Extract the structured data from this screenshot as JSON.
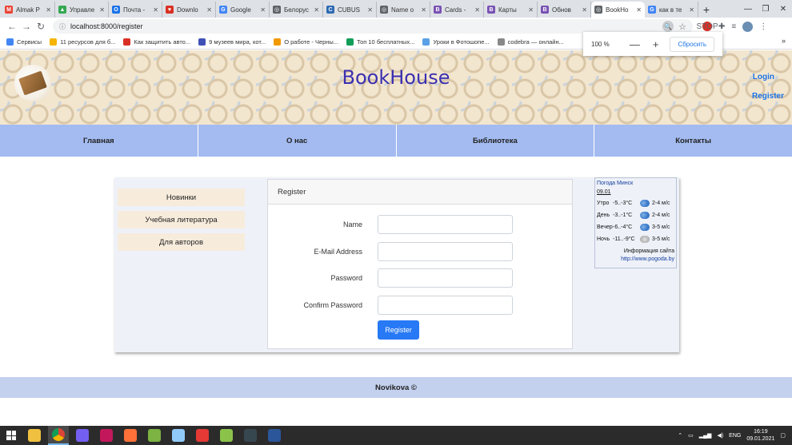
{
  "browser": {
    "tabs": [
      {
        "label": "Almak P",
        "color": "#ea4335",
        "glyph": "M",
        "active": false
      },
      {
        "label": "Управле",
        "color": "#34a853",
        "glyph": "▲",
        "active": false
      },
      {
        "label": "Почта -",
        "color": "#1a73e8",
        "glyph": "O",
        "active": false
      },
      {
        "label": "Downlo",
        "color": "#d93025",
        "glyph": "♥",
        "active": false
      },
      {
        "label": "Google",
        "color": "#4285f4",
        "glyph": "G",
        "active": false
      },
      {
        "label": "Белорус",
        "color": "#5f6368",
        "glyph": "◎",
        "active": false
      },
      {
        "label": "CUBUS",
        "color": "#2d6ab2",
        "glyph": "C",
        "active": false
      },
      {
        "label": "Name o",
        "color": "#5f6368",
        "glyph": "◎",
        "active": false
      },
      {
        "label": "Cards -",
        "color": "#7952b3",
        "glyph": "B",
        "active": false
      },
      {
        "label": "Карты",
        "color": "#7952b3",
        "glyph": "B",
        "active": false
      },
      {
        "label": "Обнов",
        "color": "#7952b3",
        "glyph": "B",
        "active": false
      },
      {
        "label": "BookHo",
        "color": "#5f6368",
        "glyph": "◎",
        "active": true
      },
      {
        "label": "как в те",
        "color": "#4285f4",
        "glyph": "G",
        "active": false
      }
    ],
    "new_tab": "+",
    "url": "localhost:8000/register",
    "bookmarks": [
      {
        "label": "Сервисы",
        "color": "#4285f4"
      },
      {
        "label": "11 ресурсов для б...",
        "color": "#f4b400"
      },
      {
        "label": "Как защитить авто...",
        "color": "#d93025"
      },
      {
        "label": "9 музеев мира, кот...",
        "color": "#3f51b5"
      },
      {
        "label": "О работе - Черны...",
        "color": "#f29900"
      },
      {
        "label": "Топ 10 бесплатных...",
        "color": "#0f9d58"
      },
      {
        "label": "Уроки в Фотошопе...",
        "color": "#5aa0e6"
      },
      {
        "label": "codebra — онлайн...",
        "color": "#888888"
      }
    ],
    "bookmarks_more": "»",
    "zoom_popup": {
      "value": "100 %",
      "minus": "—",
      "plus": "+",
      "reset": "Сбросить"
    }
  },
  "site": {
    "title": "BookHouse",
    "login": "Login",
    "register": "Register",
    "nav": [
      "Главная",
      "О нас",
      "Библиотека",
      "Контакты"
    ],
    "side_menu": [
      "Новинки",
      "Учебная литература",
      "Для авторов"
    ],
    "form": {
      "header": "Register",
      "fields": [
        {
          "label": "Name",
          "value": ""
        },
        {
          "label": "E-Mail Address",
          "value": ""
        },
        {
          "label": "Password",
          "value": ""
        },
        {
          "label": "Confirm Password",
          "value": ""
        }
      ],
      "submit": "Register"
    },
    "weather": {
      "title": "Погода Минск",
      "date": "09.01",
      "rows": [
        {
          "period": "Утро",
          "temp": "-5..-3°C",
          "wind": "2-4 м/с",
          "icon": "snow-cloud-icon"
        },
        {
          "period": "День",
          "temp": "-3..-1°C",
          "wind": "2-4 м/с",
          "icon": "snow-cloud-icon"
        },
        {
          "period": "Вечер",
          "temp": "-6..-4°C",
          "wind": "3-5 м/с",
          "icon": "snow-cloud-icon"
        },
        {
          "period": "Ночь",
          "temp": "-11..-9°C",
          "wind": "3-5 м/с",
          "icon": "cloud-icon"
        }
      ],
      "info": "Информация сайта",
      "link": "http://www.pogoda.by"
    },
    "footer": "Novikova ©"
  },
  "taskbar": {
    "apps": [
      {
        "name": "file-explorer-icon",
        "color": "#f0c040",
        "active": false
      },
      {
        "name": "chrome-icon",
        "color": "#4caf50",
        "active": true
      },
      {
        "name": "viber-icon",
        "color": "#7360f2",
        "active": false
      },
      {
        "name": "indesign-icon",
        "color": "#c2185b",
        "active": false
      },
      {
        "name": "firefox-icon",
        "color": "#ff7139",
        "active": false
      },
      {
        "name": "image-viewer-icon",
        "color": "#7cb342",
        "active": false
      },
      {
        "name": "notepad-icon",
        "color": "#90caf9",
        "active": false
      },
      {
        "name": "opera-icon",
        "color": "#e53935",
        "active": false
      },
      {
        "name": "image-editor-icon",
        "color": "#8bc34a",
        "active": false
      },
      {
        "name": "terminal-icon",
        "color": "#37474f",
        "active": false
      },
      {
        "name": "word-icon",
        "color": "#2b579a",
        "active": false
      }
    ],
    "lang": "ENG",
    "time": "16:19",
    "date": "09.01.2021"
  }
}
